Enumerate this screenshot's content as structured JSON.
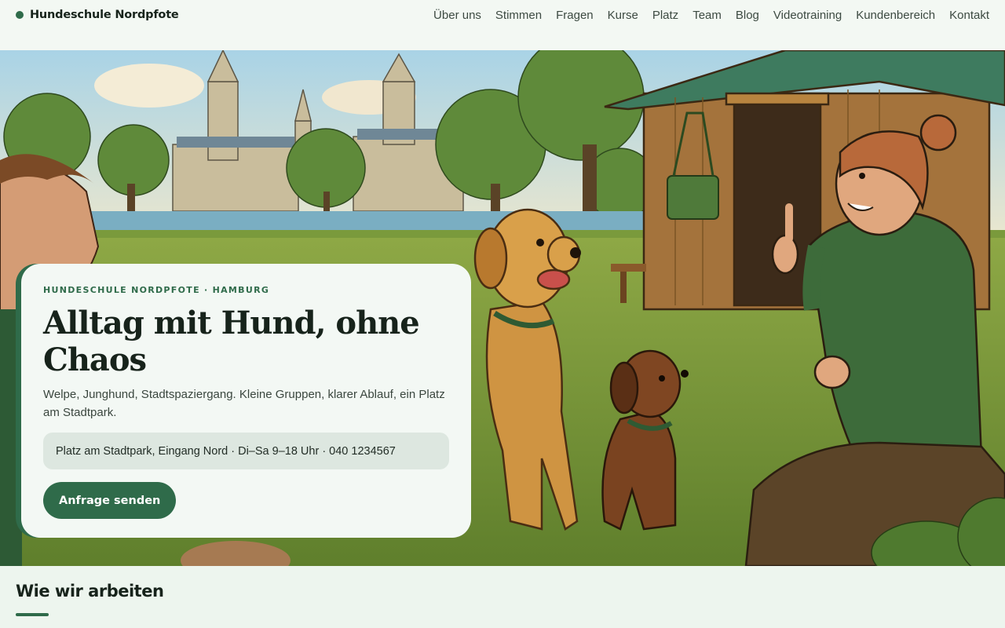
{
  "header": {
    "logo_text": "Hundeschule Nordpfote",
    "nav": [
      "Über uns",
      "Stimmen",
      "Fragen",
      "Kurse",
      "Platz",
      "Team",
      "Blog",
      "Videotraining",
      "Kundenbereich",
      "Kontakt"
    ]
  },
  "hero": {
    "eyebrow": "HUNDESCHULE NORDPFOTE · HAMBURG",
    "title": "Alltag mit Hund, ohne Chaos",
    "subtitle": "Welpe, Junghund, Stadtspaziergang. Kleine Gruppen, klarer Ablauf, ein Platz am Stadtpark.",
    "info": "Platz am Stadtpark, Eingang Nord · Di–Sa 9–18 Uhr · 040 1234567",
    "cta_label": "Anfrage senden"
  },
  "section": {
    "title": "Wie wir arbeiten"
  },
  "colors": {
    "accent": "#2f6b4a",
    "background": "#f2f7f2",
    "info_box": "#dde7e0"
  }
}
